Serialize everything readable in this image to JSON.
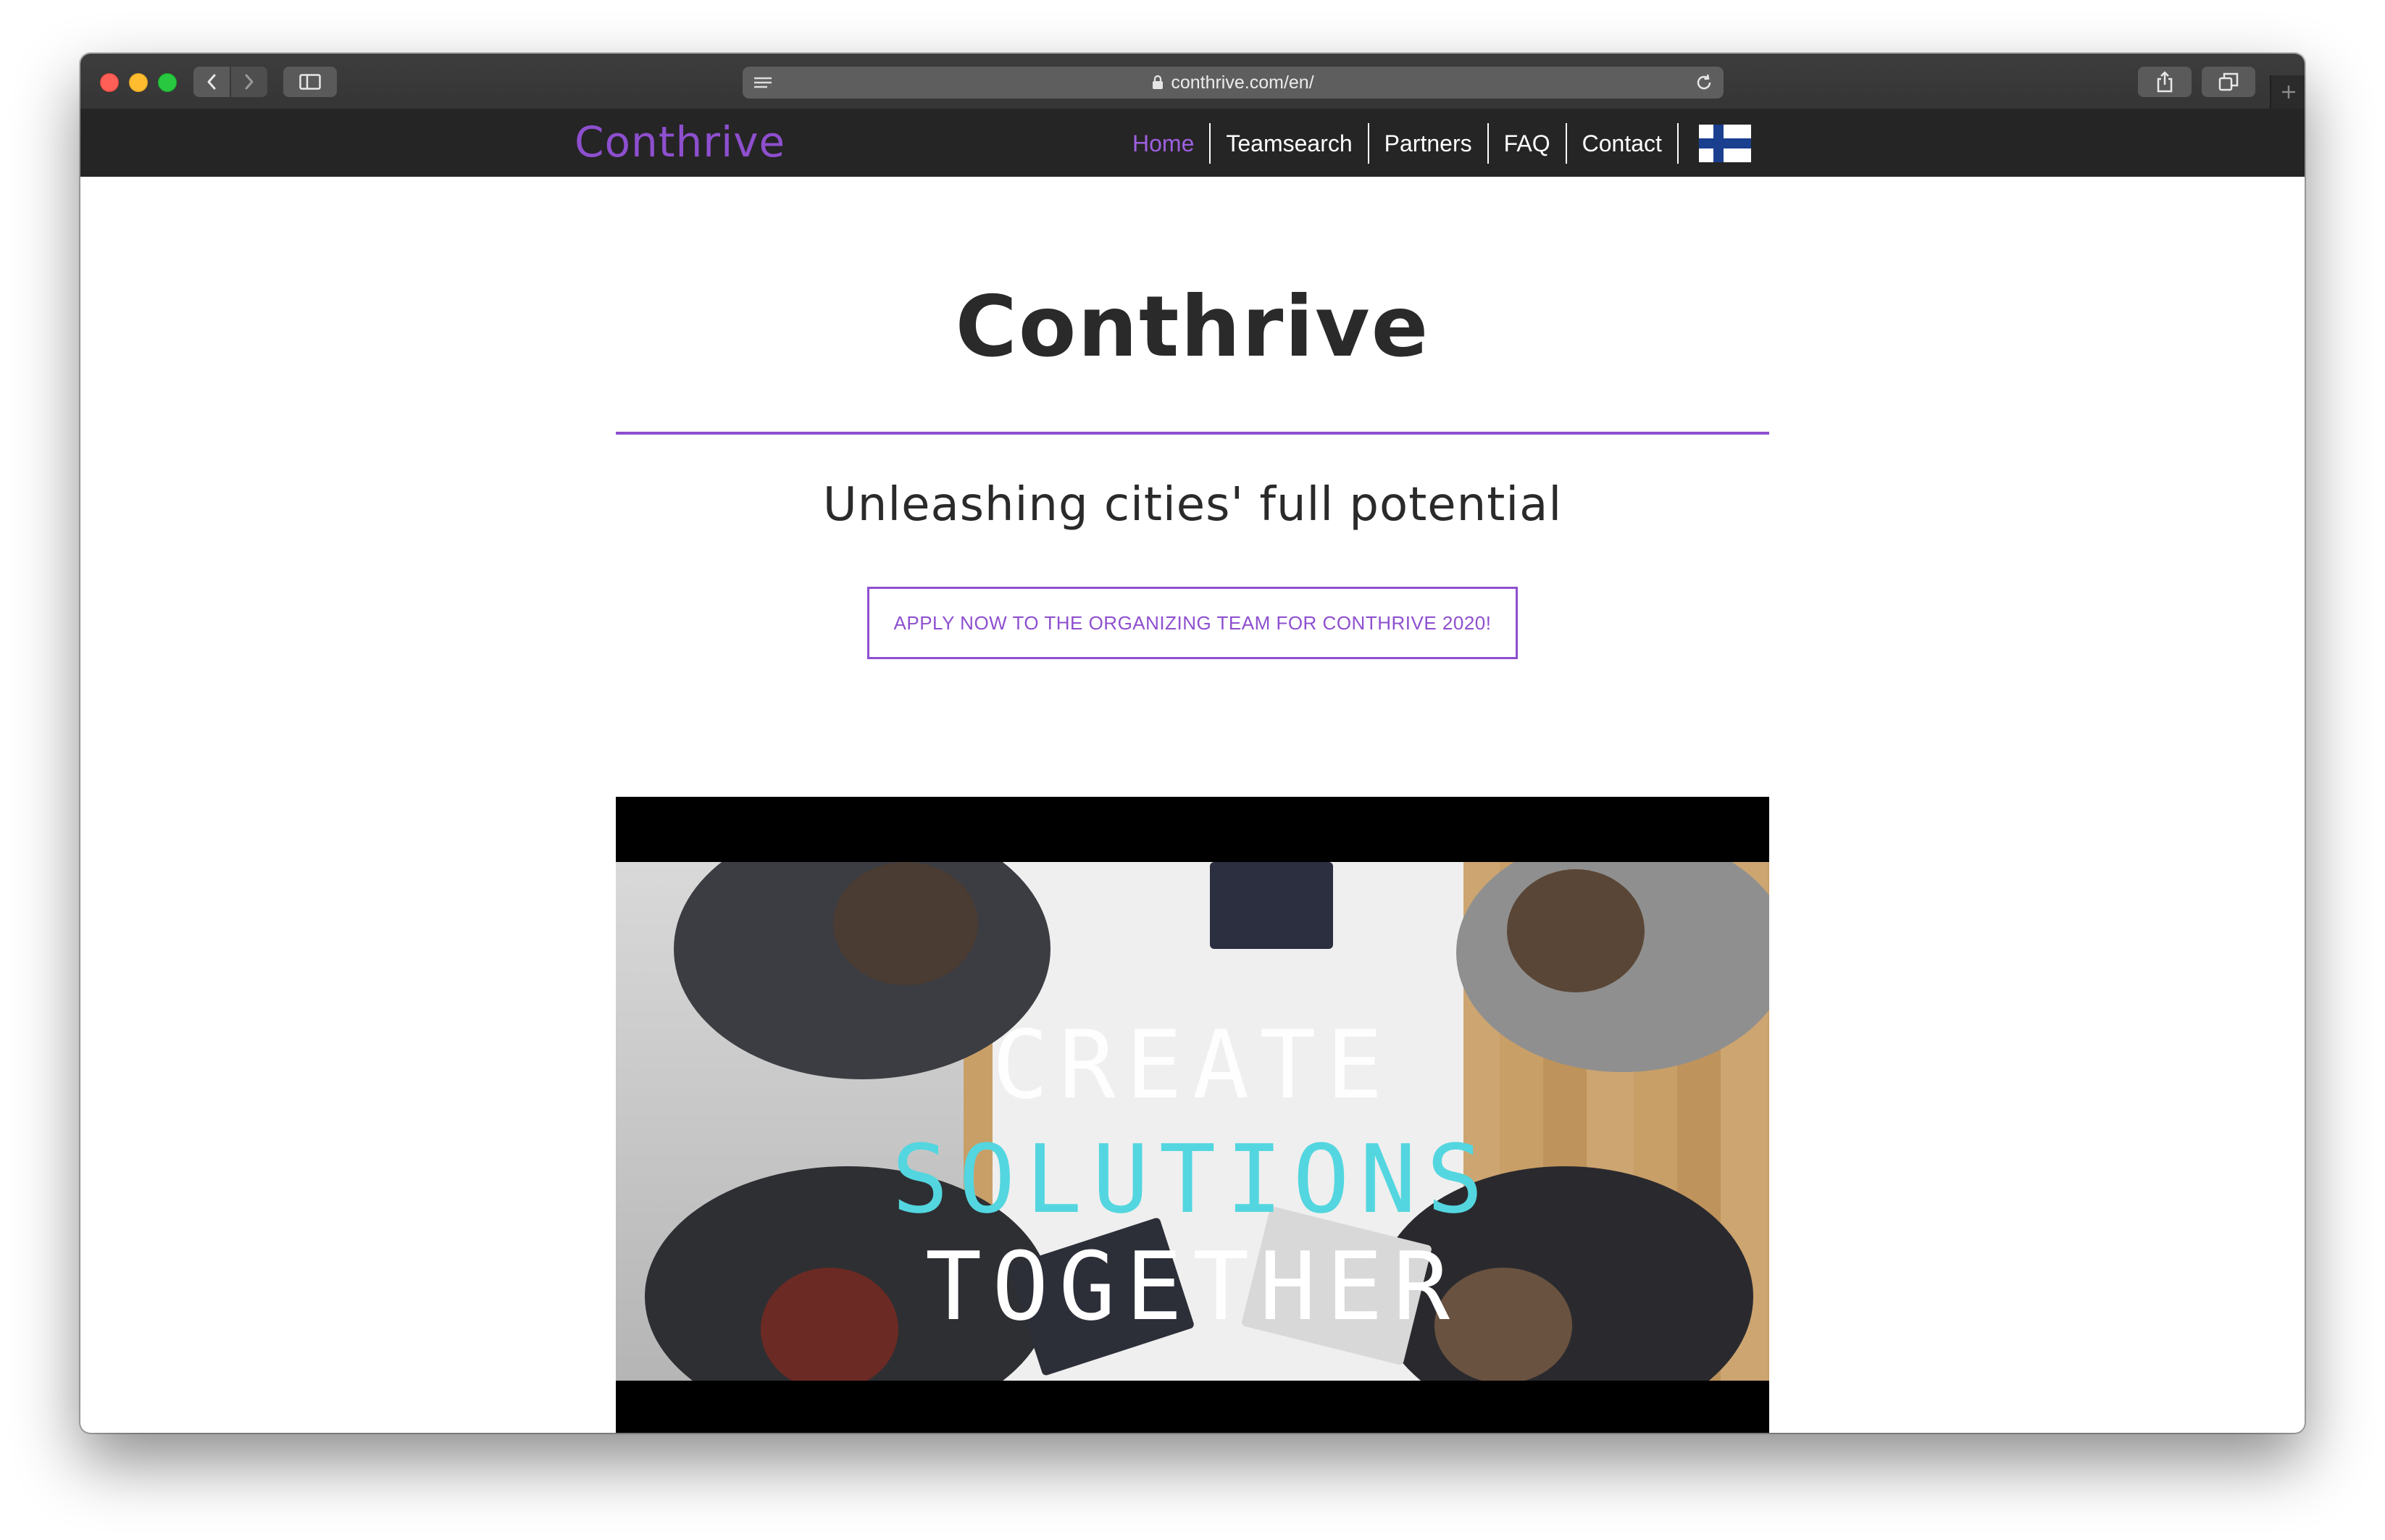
{
  "browser": {
    "url": "conthrive.com/en/"
  },
  "site": {
    "logo": "Conthrive",
    "nav": [
      {
        "label": "Home",
        "active": true
      },
      {
        "label": "Teamsearch",
        "active": false
      },
      {
        "label": "Partners",
        "active": false
      },
      {
        "label": "FAQ",
        "active": false
      },
      {
        "label": "Contact",
        "active": false
      }
    ],
    "language_flag": "finland-flag-icon"
  },
  "hero": {
    "title": "Conthrive",
    "tagline": "Unleashing cities' full potential",
    "cta": "APPLY NOW TO THE ORGANIZING TEAM FOR CONTHRIVE 2020!"
  },
  "video": {
    "line1": "CREATE",
    "line2": "SOLUTIONS",
    "line3": "TOGETHER"
  },
  "colors": {
    "accent": "#8e4fcf",
    "nav_bg": "#252525",
    "video_highlight": "#53d6df"
  }
}
